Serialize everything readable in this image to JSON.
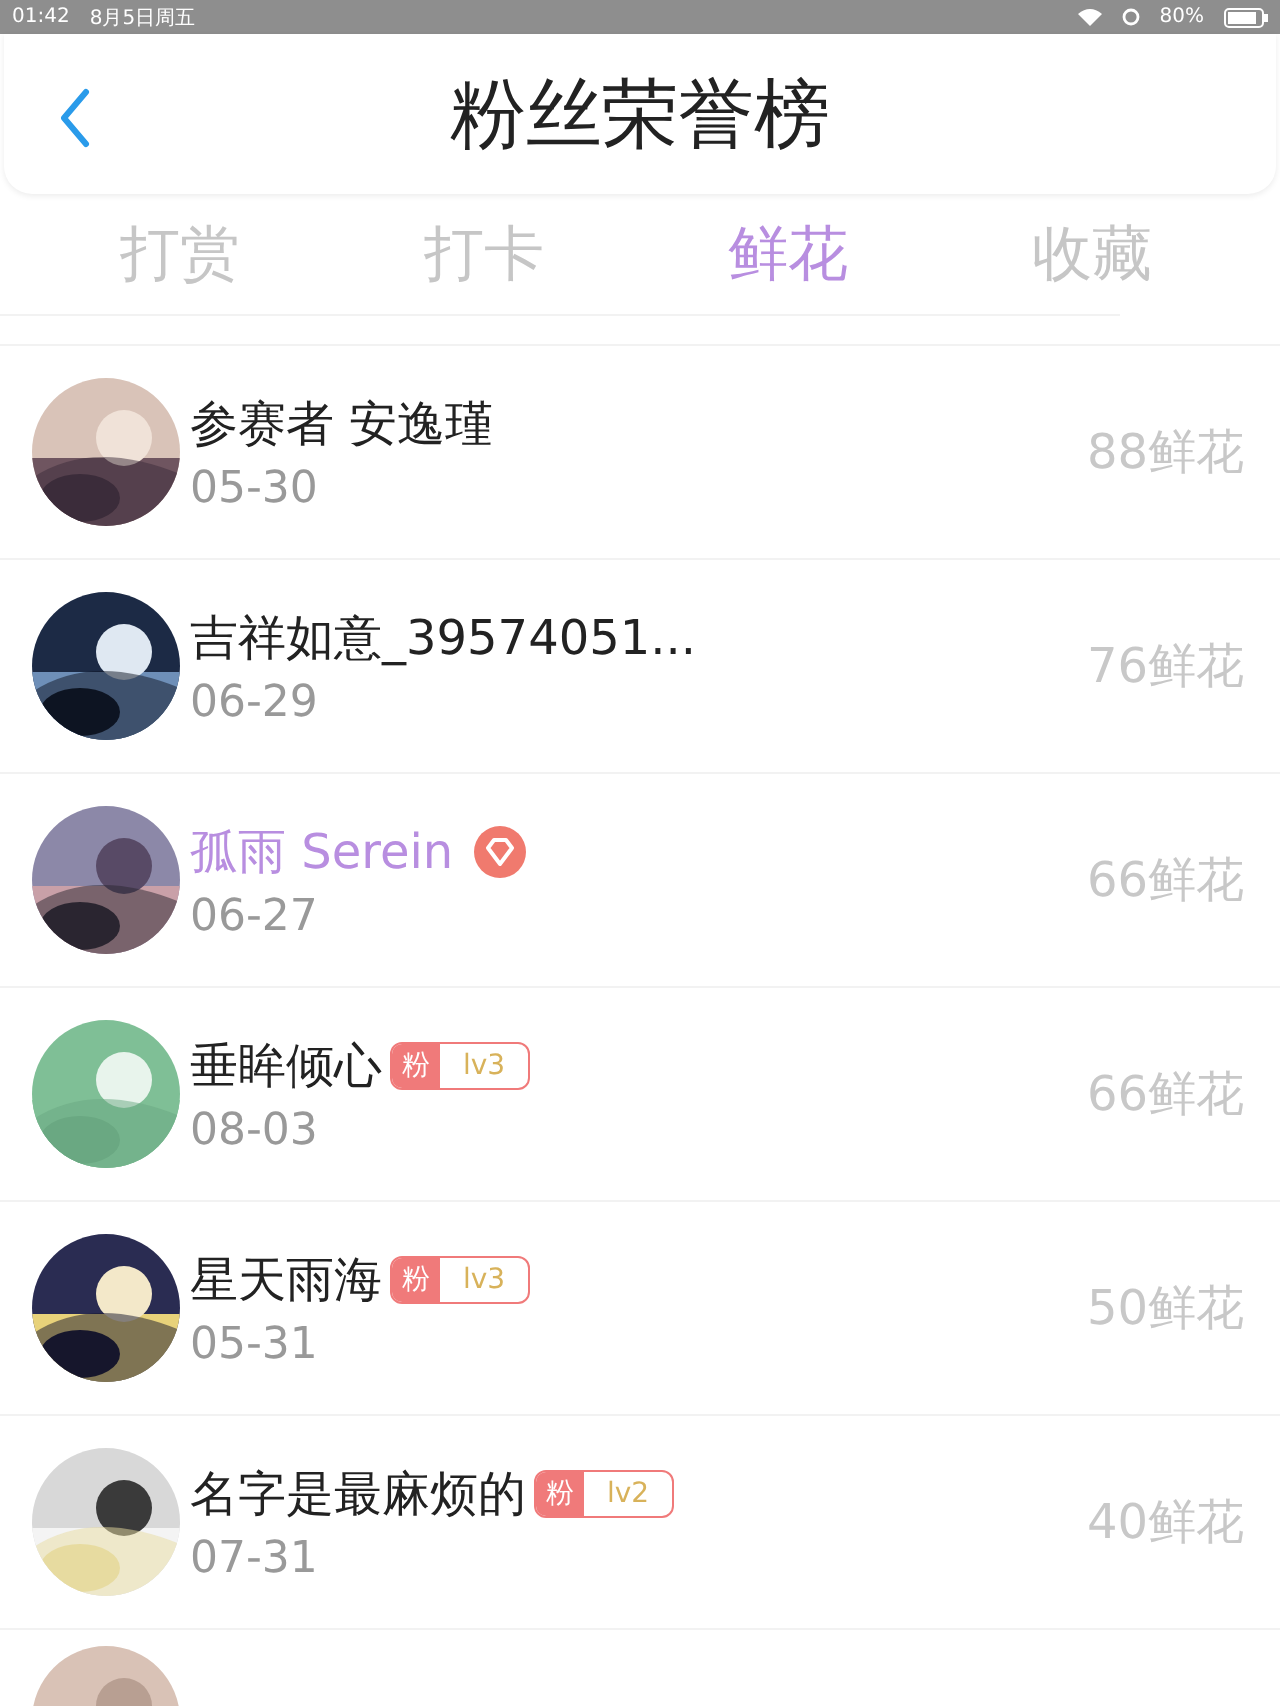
{
  "status_bar": {
    "time": "01:42",
    "date": "8月5日周五",
    "battery_text": "80%"
  },
  "header": {
    "title": "粉丝荣誉榜"
  },
  "tabs": [
    {
      "label": "打赏",
      "selected": false
    },
    {
      "label": "打卡",
      "selected": false
    },
    {
      "label": "鲜花",
      "selected": true
    },
    {
      "label": "收藏",
      "selected": false
    }
  ],
  "rows": [
    {
      "kind": "full",
      "name": "参赛者 安逸瑾",
      "vip": false,
      "date": "05-30",
      "count": "88鲜花"
    },
    {
      "kind": "full",
      "name": "吉祥如意_39574051...",
      "vip": false,
      "date": "06-29",
      "count": "76鲜花"
    },
    {
      "kind": "full",
      "name": "孤雨 Serein",
      "vip": true,
      "date": "06-27",
      "count": "66鲜花"
    },
    {
      "kind": "full",
      "name": "垂眸倾心",
      "vip": false,
      "fan_badge": {
        "label": "粉",
        "level": "lv3"
      },
      "date": "08-03",
      "count": "66鲜花"
    },
    {
      "kind": "full",
      "name": "星天雨海",
      "vip": false,
      "fan_badge": {
        "label": "粉",
        "level": "lv3"
      },
      "date": "05-31",
      "count": "50鲜花"
    },
    {
      "kind": "full",
      "name": "名字是最麻烦的",
      "vip": false,
      "fan_badge": {
        "label": "粉",
        "level": "lv2"
      },
      "date": "07-31",
      "count": "40鲜花"
    },
    {
      "kind": "partial"
    }
  ]
}
